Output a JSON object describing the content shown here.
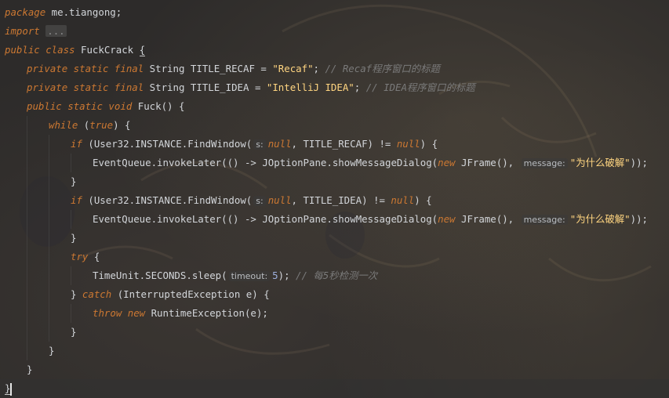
{
  "editor": {
    "language": "Java",
    "colors": {
      "keyword": "#cc7832",
      "string": "#ffd580",
      "comment": "#7a7a7a",
      "number": "#9dafdc",
      "text": "#d3d6da"
    },
    "lines": [
      {
        "indent": 0,
        "tokens": [
          {
            "t": "ikw",
            "v": "package"
          },
          {
            "t": "plain",
            "v": " me.tiangong;"
          }
        ]
      },
      {
        "indent": 0,
        "tokens": [
          {
            "t": "ikw",
            "v": "import"
          },
          {
            "t": "plain",
            "v": " "
          },
          {
            "t": "fold",
            "v": "..."
          }
        ]
      },
      {
        "indent": 0,
        "tokens": [
          {
            "t": "ikw",
            "v": "public class"
          },
          {
            "t": "plain",
            "v": " FuckCrack "
          },
          {
            "t": "bracematch",
            "v": "{"
          }
        ]
      },
      {
        "indent": 1,
        "tokens": [
          {
            "t": "ikw",
            "v": "private static final"
          },
          {
            "t": "plain",
            "v": " String TITLE_RECAF = "
          },
          {
            "t": "str",
            "v": "\"Recaf\""
          },
          {
            "t": "plain",
            "v": "; "
          },
          {
            "t": "cmt",
            "v": "// Recaf程序窗口的标题"
          }
        ]
      },
      {
        "indent": 1,
        "tokens": [
          {
            "t": "ikw",
            "v": "private static final"
          },
          {
            "t": "plain",
            "v": " String TITLE_IDEA = "
          },
          {
            "t": "str",
            "v": "\"IntelliJ IDEA\""
          },
          {
            "t": "plain",
            "v": "; "
          },
          {
            "t": "cmt",
            "v": "// IDEA程序窗口的标题"
          }
        ]
      },
      {
        "indent": 1,
        "tokens": [
          {
            "t": "ikw",
            "v": "public static void"
          },
          {
            "t": "plain",
            "v": " Fuck() {"
          }
        ]
      },
      {
        "indent": 2,
        "tokens": [
          {
            "t": "ikw",
            "v": "while"
          },
          {
            "t": "plain",
            "v": " ("
          },
          {
            "t": "ikw",
            "v": "true"
          },
          {
            "t": "plain",
            "v": ") {"
          }
        ]
      },
      {
        "indent": 3,
        "tokens": [
          {
            "t": "ikw",
            "v": "if"
          },
          {
            "t": "plain",
            "v": " (User32.INSTANCE.FindWindow("
          },
          {
            "t": "hint",
            "v": "s:"
          },
          {
            "t": "ikw",
            "v": "null"
          },
          {
            "t": "plain",
            "v": ", TITLE_RECAF) != "
          },
          {
            "t": "ikw",
            "v": "null"
          },
          {
            "t": "plain",
            "v": ") {"
          }
        ]
      },
      {
        "indent": 4,
        "tokens": [
          {
            "t": "plain",
            "v": "EventQueue.invokeLater(() -> JOptionPane.showMessageDialog("
          },
          {
            "t": "ikw",
            "v": "new"
          },
          {
            "t": "plain",
            "v": " JFrame(), "
          },
          {
            "t": "hint",
            "v": "message:"
          },
          {
            "t": "str",
            "v": "\"为什么破解\""
          },
          {
            "t": "plain",
            "v": "));"
          }
        ]
      },
      {
        "indent": 3,
        "tokens": [
          {
            "t": "plain",
            "v": "}"
          }
        ]
      },
      {
        "indent": 3,
        "tokens": [
          {
            "t": "ikw",
            "v": "if"
          },
          {
            "t": "plain",
            "v": " (User32.INSTANCE.FindWindow("
          },
          {
            "t": "hint",
            "v": "s:"
          },
          {
            "t": "ikw",
            "v": "null"
          },
          {
            "t": "plain",
            "v": ", TITLE_IDEA) != "
          },
          {
            "t": "ikw",
            "v": "null"
          },
          {
            "t": "plain",
            "v": ") {"
          }
        ]
      },
      {
        "indent": 4,
        "tokens": [
          {
            "t": "plain",
            "v": "EventQueue.invokeLater(() -> JOptionPane.showMessageDialog("
          },
          {
            "t": "ikw",
            "v": "new"
          },
          {
            "t": "plain",
            "v": " JFrame(), "
          },
          {
            "t": "hint",
            "v": "message:"
          },
          {
            "t": "str",
            "v": "\"为什么破解\""
          },
          {
            "t": "plain",
            "v": "));"
          }
        ]
      },
      {
        "indent": 3,
        "tokens": [
          {
            "t": "plain",
            "v": "}"
          }
        ]
      },
      {
        "indent": 3,
        "tokens": [
          {
            "t": "ikw",
            "v": "try"
          },
          {
            "t": "plain",
            "v": " {"
          }
        ]
      },
      {
        "indent": 4,
        "tokens": [
          {
            "t": "plain",
            "v": "TimeUnit.SECONDS.sleep("
          },
          {
            "t": "hint",
            "v": "timeout:"
          },
          {
            "t": "num",
            "v": "5"
          },
          {
            "t": "plain",
            "v": "); "
          },
          {
            "t": "cmt",
            "v": "// 每5秒检测一次"
          }
        ]
      },
      {
        "indent": 3,
        "tokens": [
          {
            "t": "plain",
            "v": "} "
          },
          {
            "t": "ikw",
            "v": "catch"
          },
          {
            "t": "plain",
            "v": " (InterruptedException e) {"
          }
        ]
      },
      {
        "indent": 4,
        "tokens": [
          {
            "t": "ikw",
            "v": "throw new"
          },
          {
            "t": "plain",
            "v": " RuntimeException(e);"
          }
        ]
      },
      {
        "indent": 3,
        "tokens": [
          {
            "t": "plain",
            "v": "}"
          }
        ]
      },
      {
        "indent": 2,
        "tokens": [
          {
            "t": "plain",
            "v": "}"
          }
        ]
      },
      {
        "indent": 1,
        "tokens": [
          {
            "t": "plain",
            "v": "}"
          }
        ]
      },
      {
        "indent": 0,
        "current": true,
        "tokens": [
          {
            "t": "bracematch",
            "v": "}"
          },
          {
            "t": "caret",
            "v": ""
          }
        ]
      }
    ]
  }
}
